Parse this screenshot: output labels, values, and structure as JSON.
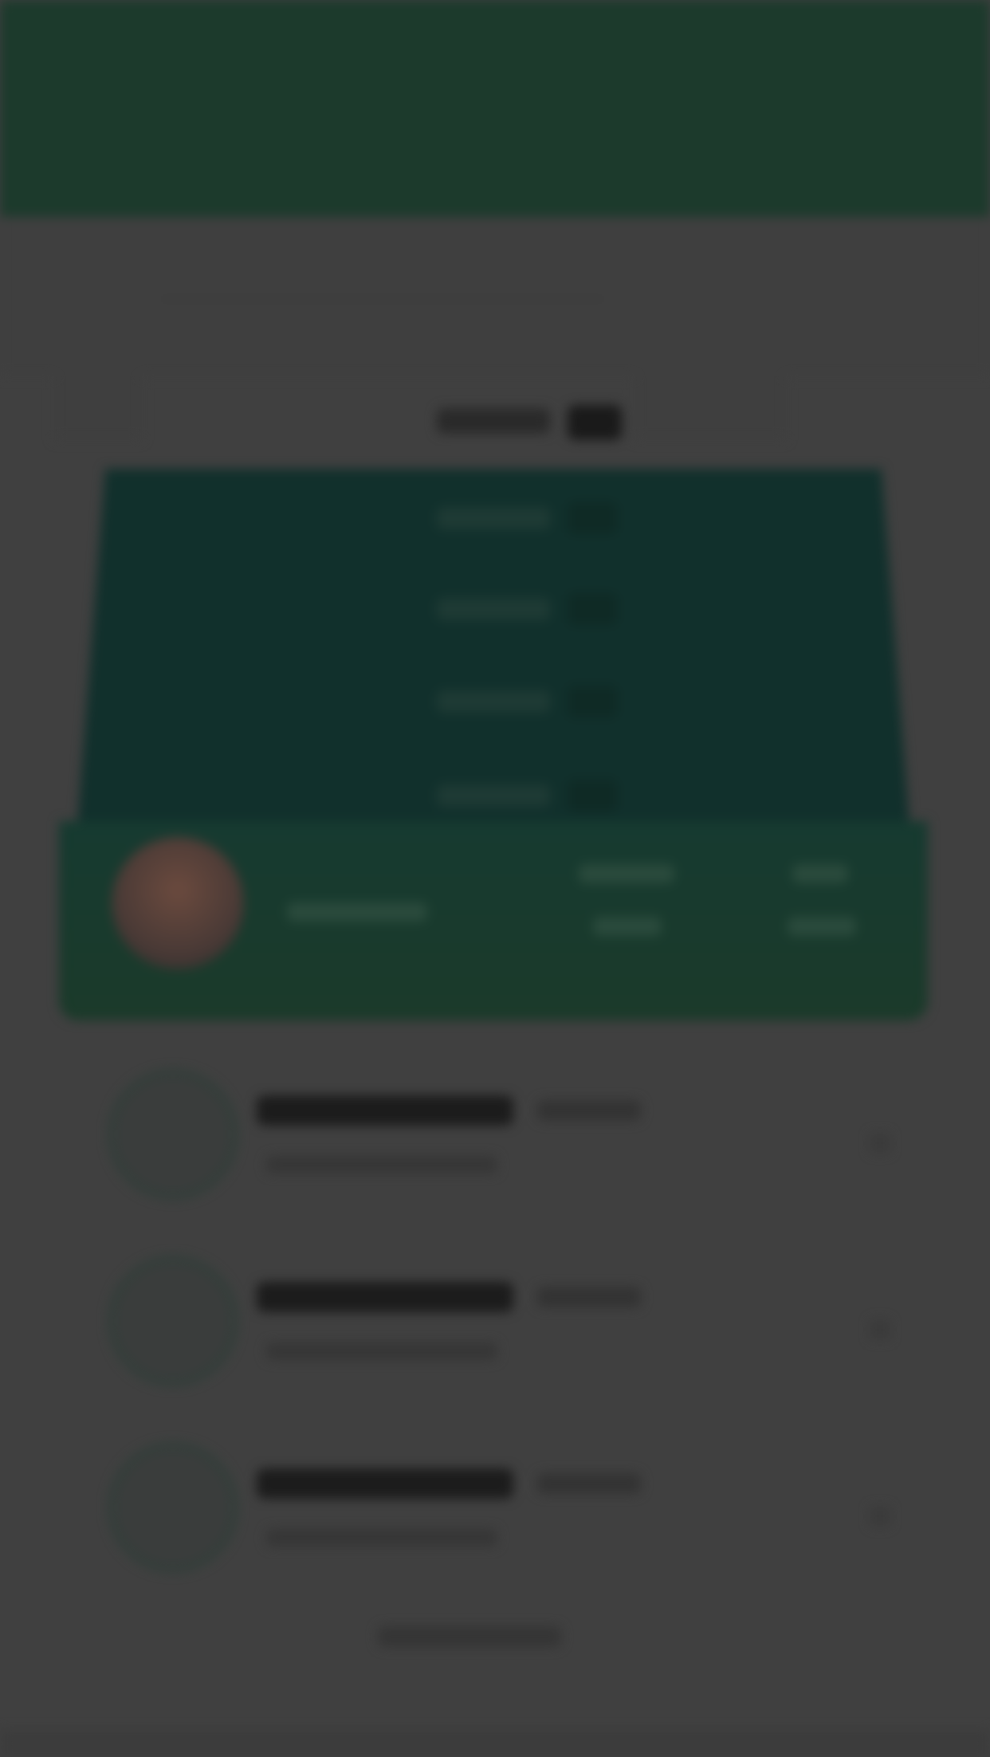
{
  "header": {
    "background": "#1c3a2c"
  },
  "tabs": [],
  "leaderboard": {
    "title": "",
    "rank_rows": [
      {
        "label": "",
        "badge": ""
      },
      {
        "label": "",
        "badge": ""
      },
      {
        "label": "",
        "badge": ""
      },
      {
        "label": "",
        "badge": ""
      }
    ],
    "current_user": {
      "name": "",
      "stat_1": {
        "label": "",
        "value": ""
      },
      "stat_2": {
        "label": "",
        "value": ""
      }
    },
    "colors": {
      "card": "#11302c",
      "card_bottom": "#1b3a2a",
      "overlay": "#404040"
    }
  },
  "list": {
    "items": [
      {
        "name": "",
        "tag": "",
        "subtitle": ""
      },
      {
        "name": "",
        "tag": "",
        "subtitle": ""
      },
      {
        "name": "",
        "tag": "",
        "subtitle": ""
      }
    ]
  },
  "footer": {
    "link_label": ""
  }
}
